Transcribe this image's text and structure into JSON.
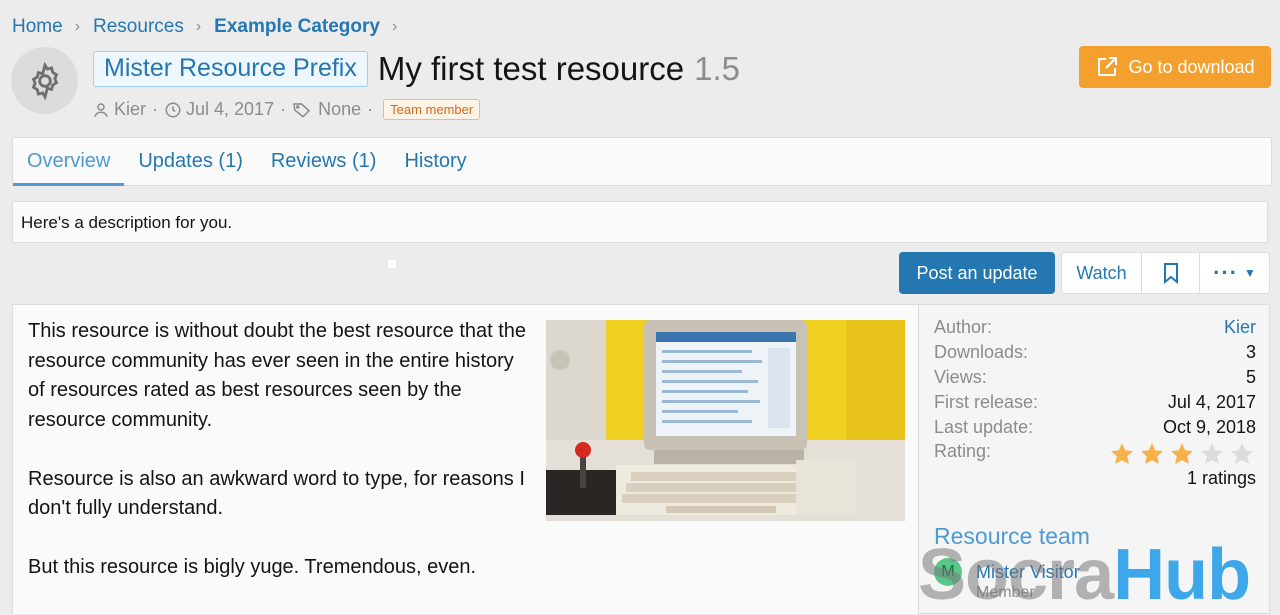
{
  "breadcrumb": {
    "items": [
      "Home",
      "Resources",
      "Example Category"
    ]
  },
  "resource": {
    "prefix": "Mister Resource Prefix",
    "title": "My first test resource",
    "version": "1.5",
    "author": "Kier",
    "date": "Jul 4, 2017",
    "tags": "None",
    "badge": "Team member"
  },
  "download_button": {
    "label": "Go to download"
  },
  "tabs": [
    {
      "label": "Overview",
      "active": true
    },
    {
      "label": "Updates (1)",
      "active": false
    },
    {
      "label": "Reviews (1)",
      "active": false
    },
    {
      "label": "History",
      "active": false
    }
  ],
  "description": "Here's a description for you.",
  "actions": {
    "post_update": "Post an update",
    "watch": "Watch",
    "bookmark_icon": "bookmark-icon",
    "more_icon": "more-options-icon"
  },
  "body": {
    "paragraphs": [
      "This resource is without doubt the best resource that the resource community has ever seen in the entire history of resources rated as best resources seen by the resource community.",
      "Resource is also an awkward word to type, for reasons I don't fully understand.",
      "But this resource is bigly yuge. Tremendous, even."
    ]
  },
  "info": {
    "author_label": "Author:",
    "author_value": "Kier",
    "downloads_label": "Downloads:",
    "downloads_value": "3",
    "views_label": "Views:",
    "views_value": "5",
    "first_release_label": "First release:",
    "first_release_value": "Jul 4, 2017",
    "last_update_label": "Last update:",
    "last_update_value": "Oct 9, 2018",
    "rating_label": "Rating:",
    "rating_stars": 3,
    "rating_max": 5,
    "ratings_count": "1 ratings"
  },
  "team": {
    "title": "Resource team",
    "members": [
      {
        "initial": "M",
        "name": "Mister Visitor",
        "role": "Member"
      }
    ]
  },
  "watermark": {
    "part1": "Socra",
    "part2": "Hub"
  },
  "colors": {
    "link": "#2577b1",
    "accent": "#4e9ad2",
    "download": "#f4a02f",
    "star_on": "#f8b04a",
    "star_off": "#dcdcdc"
  }
}
